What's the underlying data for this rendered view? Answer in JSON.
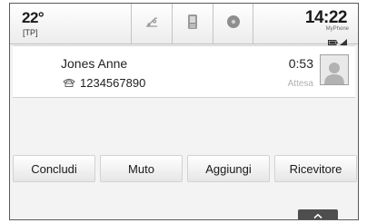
{
  "status_bar": {
    "temperature": "22°",
    "traffic_label": "[TP]",
    "time": "14:22",
    "device_name": "MyPhone",
    "tabs": [
      {
        "icon": "music-note-icon"
      },
      {
        "icon": "phone-handset-icon"
      },
      {
        "icon": "navigation-icon"
      }
    ],
    "indicators": [
      "battery-icon",
      "signal-strength-icon"
    ]
  },
  "call": {
    "caller_name": "Jones Anne",
    "number": "1234567890",
    "number_icon": "phone-type-icon",
    "duration": "0:53",
    "status": "Attesa",
    "avatar_icon": "contact-avatar-icon"
  },
  "actions": {
    "end": "Concludi",
    "mute": "Muto",
    "add": "Aggiungi",
    "receiver": "Ricevitore"
  },
  "bottom_handle": {
    "icon": "chevron-up-icon"
  }
}
